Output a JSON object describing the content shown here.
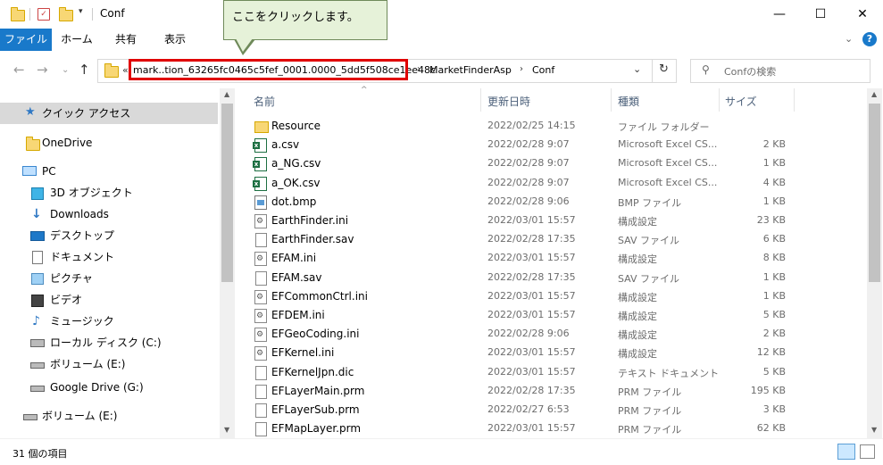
{
  "window": {
    "title": "Conf"
  },
  "ribbon": {
    "tabs": [
      "ファイル",
      "ホーム",
      "共有",
      "表示"
    ]
  },
  "address": {
    "overflow": "«",
    "segments": [
      "mark..tion_63265fc0465c5fef_0001.0000_5dd5f508ce1ee48c",
      "MarketFinderAsp",
      "Conf"
    ]
  },
  "search": {
    "placeholder": "Confの検索"
  },
  "callout": {
    "text": "ここをクリックします。"
  },
  "sidebar": {
    "items": [
      {
        "label": "クイック アクセス",
        "icon": "star-icon"
      },
      {
        "label": "OneDrive",
        "icon": "folder-icon"
      },
      {
        "label": "PC",
        "icon": "pc-icon"
      },
      {
        "label": "3D オブジェクト",
        "icon": "cube-icon"
      },
      {
        "label": "Downloads",
        "icon": "download-icon"
      },
      {
        "label": "デスクトップ",
        "icon": "desktop-icon"
      },
      {
        "label": "ドキュメント",
        "icon": "document-icon"
      },
      {
        "label": "ピクチャ",
        "icon": "picture-icon"
      },
      {
        "label": "ビデオ",
        "icon": "video-icon"
      },
      {
        "label": "ミュージック",
        "icon": "music-icon"
      },
      {
        "label": "ローカル ディスク (C:)",
        "icon": "drive-icon"
      },
      {
        "label": "ボリューム (E:)",
        "icon": "drive-icon"
      },
      {
        "label": "Google Drive (G:)",
        "icon": "drive-icon"
      },
      {
        "label": "ボリューム (E:)",
        "icon": "drive-icon"
      }
    ]
  },
  "columns": {
    "name": "名前",
    "date": "更新日時",
    "type": "種類",
    "size": "サイズ"
  },
  "files": [
    {
      "name": "Resource",
      "date": "2022/02/25 14:15",
      "type": "ファイル フォルダー",
      "size": "",
      "icon": "folder-icon"
    },
    {
      "name": "a.csv",
      "date": "2022/02/28 9:07",
      "type": "Microsoft Excel CS...",
      "size": "2 KB",
      "icon": "excel-icon"
    },
    {
      "name": "a_NG.csv",
      "date": "2022/02/28 9:07",
      "type": "Microsoft Excel CS...",
      "size": "1 KB",
      "icon": "excel-icon"
    },
    {
      "name": "a_OK.csv",
      "date": "2022/02/28 9:07",
      "type": "Microsoft Excel CS...",
      "size": "4 KB",
      "icon": "excel-icon"
    },
    {
      "name": "dot.bmp",
      "date": "2022/02/28 9:06",
      "type": "BMP ファイル",
      "size": "1 KB",
      "icon": "bitmap-icon"
    },
    {
      "name": "EarthFinder.ini",
      "date": "2022/03/01 15:57",
      "type": "構成設定",
      "size": "23 KB",
      "icon": "settings-file-icon"
    },
    {
      "name": "EarthFinder.sav",
      "date": "2022/02/28 17:35",
      "type": "SAV ファイル",
      "size": "6 KB",
      "icon": "file-icon"
    },
    {
      "name": "EFAM.ini",
      "date": "2022/03/01 15:57",
      "type": "構成設定",
      "size": "8 KB",
      "icon": "settings-file-icon"
    },
    {
      "name": "EFAM.sav",
      "date": "2022/02/28 17:35",
      "type": "SAV ファイル",
      "size": "1 KB",
      "icon": "file-icon"
    },
    {
      "name": "EFCommonCtrl.ini",
      "date": "2022/03/01 15:57",
      "type": "構成設定",
      "size": "1 KB",
      "icon": "settings-file-icon"
    },
    {
      "name": "EFDEM.ini",
      "date": "2022/03/01 15:57",
      "type": "構成設定",
      "size": "5 KB",
      "icon": "settings-file-icon"
    },
    {
      "name": "EFGeoCoding.ini",
      "date": "2022/02/28 9:06",
      "type": "構成設定",
      "size": "2 KB",
      "icon": "settings-file-icon"
    },
    {
      "name": "EFKernel.ini",
      "date": "2022/03/01 15:57",
      "type": "構成設定",
      "size": "12 KB",
      "icon": "settings-file-icon"
    },
    {
      "name": "EFKernelJpn.dic",
      "date": "2022/03/01 15:57",
      "type": "テキスト ドキュメント",
      "size": "5 KB",
      "icon": "file-icon"
    },
    {
      "name": "EFLayerMain.prm",
      "date": "2022/02/28 17:35",
      "type": "PRM ファイル",
      "size": "195 KB",
      "icon": "file-icon"
    },
    {
      "name": "EFLayerSub.prm",
      "date": "2022/02/27 6:53",
      "type": "PRM ファイル",
      "size": "3 KB",
      "icon": "file-icon"
    },
    {
      "name": "EFMapLayer.prm",
      "date": "2022/03/01 15:57",
      "type": "PRM ファイル",
      "size": "62 KB",
      "icon": "file-icon"
    }
  ],
  "status": {
    "count": "31 個の項目"
  },
  "colors": {
    "accent": "#1979ca",
    "highlight": "#e00000",
    "callout_bg": "#e6f2d9"
  }
}
